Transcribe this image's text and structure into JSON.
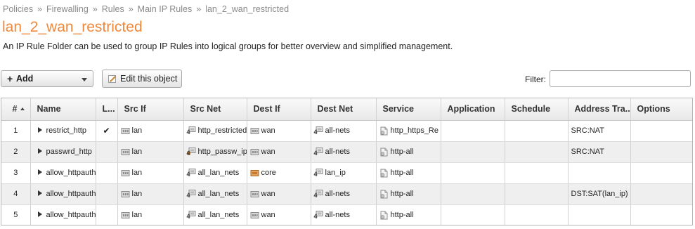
{
  "breadcrumb": {
    "items": [
      "Policies",
      "Firewalling",
      "Rules",
      "Main IP Rules"
    ],
    "current": "lan_2_wan_restricted",
    "separator": "»"
  },
  "page": {
    "title": "lan_2_wan_restricted",
    "description": "An IP Rule Folder can be used to group IP Rules into logical groups for better overview and simplified management."
  },
  "toolbar": {
    "add_label": "Add",
    "add_prefix": "+",
    "edit_label": "Edit this object",
    "filter_label": "Filter:",
    "filter_value": ""
  },
  "colors": {
    "title": "#f0883c",
    "row_alt": "#efefef",
    "border": "#b5b5b5"
  },
  "table": {
    "headers": {
      "num": "#",
      "name": "Name",
      "log": "L...",
      "src_if": "Src If",
      "src_net": "Src Net",
      "dest_if": "Dest If",
      "dest_net": "Dest Net",
      "service": "Service",
      "application": "Application",
      "schedule": "Schedule",
      "address_translation": "Address Tra...",
      "options": "Options"
    },
    "sort": {
      "column": "#",
      "direction": "ascending"
    },
    "rows": [
      {
        "num": "1",
        "name": "restrict_http",
        "log": "✔",
        "src_if": "lan",
        "src_if_icon": "interface-icon",
        "src_net": "http_restricted",
        "src_net_icon": "network-icon",
        "dest_if": "wan",
        "dest_if_icon": "interface-icon",
        "dest_net": "all-nets",
        "dest_net_icon": "network-icon",
        "service": "http_https_Re",
        "service_icon": "service-icon",
        "application": "",
        "schedule": "",
        "address_translation": "SRC:NAT",
        "options": ""
      },
      {
        "num": "2",
        "name": "passwrd_http",
        "log": "",
        "src_if": "lan",
        "src_if_icon": "interface-icon",
        "src_net": "http_passw_ip",
        "src_net_icon": "network-group-icon",
        "dest_if": "wan",
        "dest_if_icon": "interface-icon",
        "dest_net": "all-nets",
        "dest_net_icon": "network-icon",
        "service": "http-all",
        "service_icon": "service-icon",
        "application": "",
        "schedule": "",
        "address_translation": "SRC:NAT",
        "options": ""
      },
      {
        "num": "3",
        "name": "allow_httpauth",
        "log": "",
        "src_if": "lan",
        "src_if_icon": "interface-icon",
        "src_net": "all_lan_nets",
        "src_net_icon": "network-icon",
        "dest_if": "core",
        "dest_if_icon": "core-icon",
        "dest_net": "lan_ip",
        "dest_net_icon": "network-icon",
        "service": "http-all",
        "service_icon": "service-icon",
        "application": "",
        "schedule": "",
        "address_translation": "",
        "options": ""
      },
      {
        "num": "4",
        "name": "allow_httpauth",
        "log": "",
        "src_if": "lan",
        "src_if_icon": "interface-icon",
        "src_net": "all_lan_nets",
        "src_net_icon": "network-icon",
        "dest_if": "wan",
        "dest_if_icon": "interface-icon",
        "dest_net": "all-nets",
        "dest_net_icon": "network-icon",
        "service": "http-all",
        "service_icon": "service-icon",
        "application": "",
        "schedule": "",
        "address_translation": "DST:SAT(lan_ip)",
        "options": ""
      },
      {
        "num": "5",
        "name": "allow_httpauth",
        "log": "",
        "src_if": "lan",
        "src_if_icon": "interface-icon",
        "src_net": "all_lan_nets",
        "src_net_icon": "network-icon",
        "dest_if": "wan",
        "dest_if_icon": "interface-icon",
        "dest_net": "all-nets",
        "dest_net_icon": "network-icon",
        "service": "http-all",
        "service_icon": "service-icon",
        "application": "",
        "schedule": "",
        "address_translation": "",
        "options": ""
      }
    ]
  }
}
